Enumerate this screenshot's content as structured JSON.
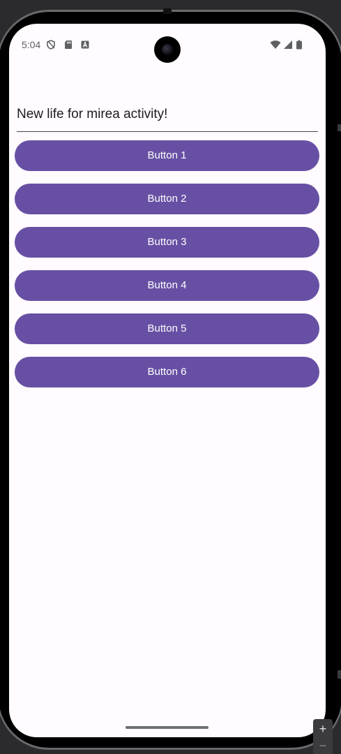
{
  "status_bar": {
    "time": "5:04",
    "left_icons": [
      "shield-icon",
      "sd-card-icon",
      "a-badge-icon"
    ],
    "right_icons": [
      "wifi-icon",
      "signal-icon",
      "battery-icon"
    ]
  },
  "main": {
    "title_field_value": "New life for mirea activity!",
    "buttons": [
      {
        "label": "Button 1"
      },
      {
        "label": "Button 2"
      },
      {
        "label": "Button 3"
      },
      {
        "label": "Button 4"
      },
      {
        "label": "Button 5"
      },
      {
        "label": "Button 6"
      }
    ]
  },
  "emulator_controls": {
    "zoom_in": "+",
    "zoom_out": "−"
  },
  "colors": {
    "primary": "#6750a4",
    "surface": "#fffbfe",
    "on_primary": "#ffffff",
    "frame": "#2b2b2d"
  }
}
